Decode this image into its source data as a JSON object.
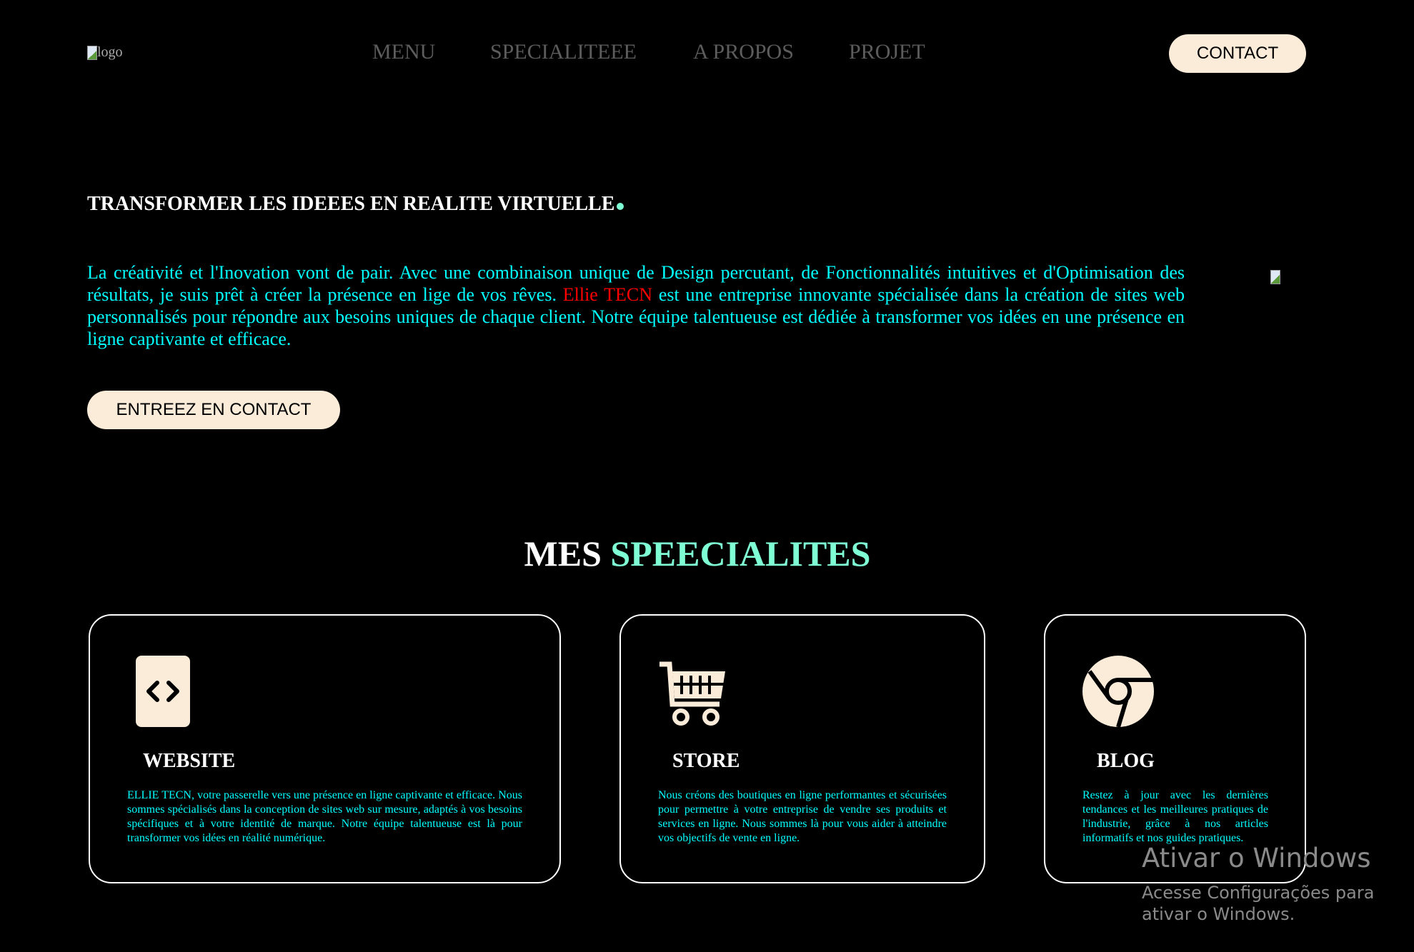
{
  "header": {
    "logo_alt": "logo",
    "nav": [
      "MENU",
      "SPECIALITEEE",
      "A PROPOS",
      "PROJET"
    ],
    "contact_label": "CONTACT"
  },
  "hero": {
    "title": "TRANSFORMER LES IDEEES EN REALITE VIRTUELLE",
    "paragraph_part1": "La créativité et l'Inovation vont de pair. Avec une combinaison unique de Design percutant, de Fonctionnalités intuitives et d'Optimisation des résultats, je suis prêt à créer la présence en lige de vos rêves. ",
    "brand": "Ellie TECN",
    "paragraph_part2": " est une entreprise innovante spécialisée dans la création de sites web personnalisés pour répondre aux besoins uniques de chaque client. Notre équipe talentueuse est dédiée à transformer vos idées en une présence en ligne captivante et efficace.",
    "cta_label": "ENTREEZ EN CONTACT"
  },
  "specialties": {
    "title_white": "MES",
    "title_accent": "SPEECIALITES",
    "cards": [
      {
        "title": "WEBSITE",
        "text": "ELLIE TECN, votre passerelle vers une présence en ligne captivante et efficace. Nous sommes spécialisés dans la conception de sites web sur mesure, adaptés à vos besoins spécifiques et à votre identité de marque. Notre équipe talentueuse est là pour transformer vos idées en réalité numérique."
      },
      {
        "title": "STORE",
        "text": "Nous créons des boutiques en ligne performantes et sécurisées pour permettre à votre entreprise de vendre ses produits et services en ligne. Nous sommes là pour vous aider à atteindre vos objectifs de vente en ligne."
      },
      {
        "title": "BLOG",
        "text": "Restez à jour avec les dernières tendances et les meilleures pratiques de l'industrie, grâce à nos articles informatifs et nos guides pratiques."
      }
    ]
  },
  "watermark": {
    "line1": "Ativar o Windows",
    "line2": "Acesse Configurações para ativar o Windows."
  },
  "colors": {
    "accent": "#7fffd4",
    "text": "#00ffff",
    "button": "#fbebd9",
    "brand": "#ff0000"
  }
}
